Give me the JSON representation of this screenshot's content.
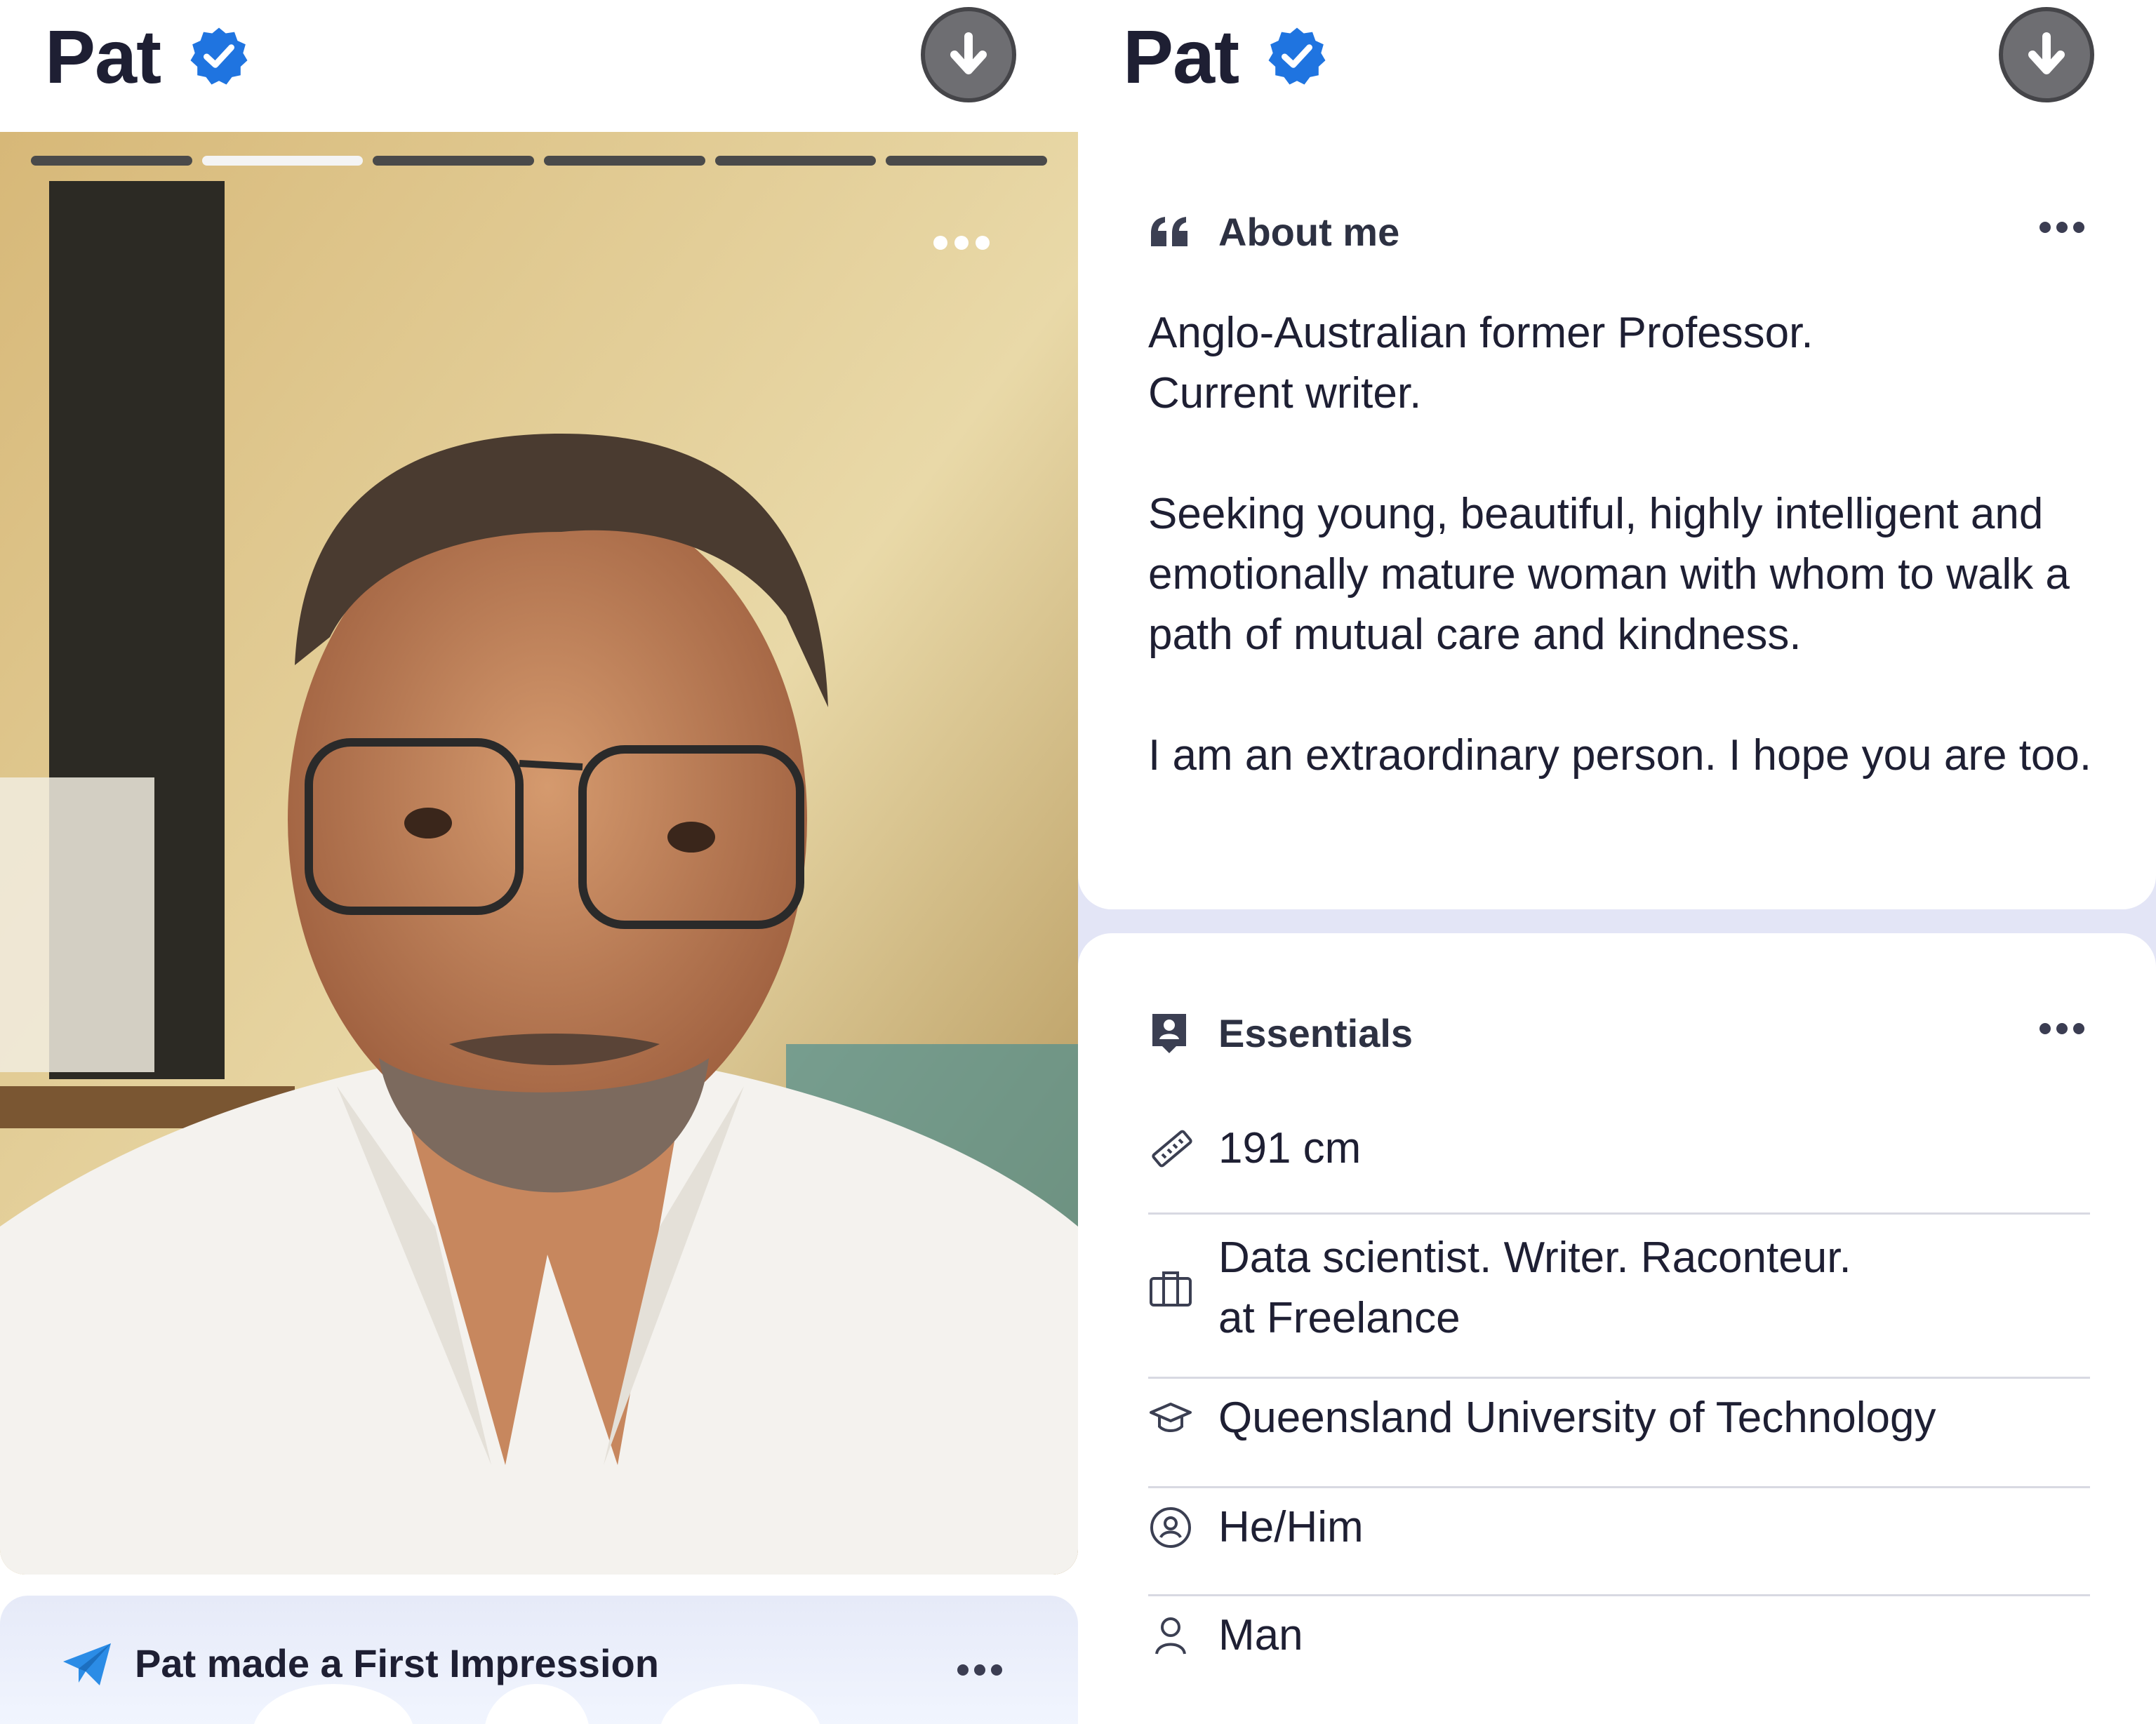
{
  "left": {
    "profile_name": "Pat",
    "photo": {
      "count": 6,
      "active_index": 1
    },
    "impression": {
      "label": "Pat made a First Impression"
    }
  },
  "right": {
    "profile_name": "Pat",
    "about": {
      "title": "About me",
      "text": "Anglo-Australian former Professor.\nCurrent writer.\n\nSeeking young, beautiful, highly intelligent and emotionally mature woman with whom to walk a path of mutual care and kindness.\n\nI am an extraordinary person. I hope you are too."
    },
    "essentials": {
      "title": "Essentials",
      "height": "191 cm",
      "work_line1": "Data scientist. Writer. Raconteur.",
      "work_line2": "at Freelance",
      "education": "Queensland University of Technology",
      "pronouns": "He/Him",
      "gender": "Man"
    }
  },
  "colors": {
    "verified_blue": "#1f74e0",
    "accent_blue": "#2b8ce6",
    "text_dark": "#1e1f33",
    "page_bg": "#dfe2f2"
  },
  "icons": [
    "verified-badge-icon",
    "download-icon",
    "more-dots-icon",
    "paper-plane-icon",
    "quote-icon",
    "id-badge-icon",
    "ruler-icon",
    "briefcase-icon",
    "graduation-cap-icon",
    "pronoun-icon",
    "person-icon"
  ]
}
